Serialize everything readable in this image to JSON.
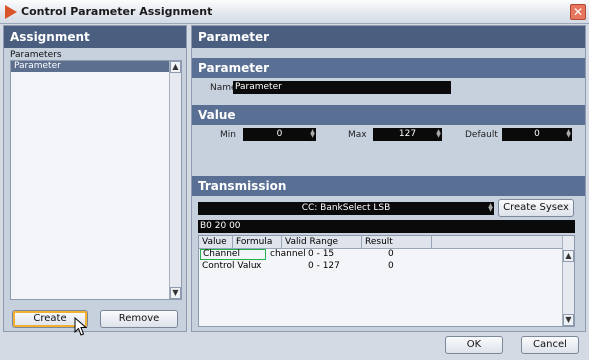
{
  "window": {
    "title": "Control Parameter Assignment",
    "close_glyph": "✕"
  },
  "assignment": {
    "header": "Assignment",
    "parameters_label": "Parameters",
    "list_items": [
      "Parameter"
    ],
    "create_label": "Create",
    "remove_label": "Remove"
  },
  "parameter_panel": {
    "header": "Parameter",
    "section_title": "Parameter",
    "name_label": "Name",
    "name_value": "Parameter"
  },
  "value": {
    "title": "Value",
    "min_label": "Min",
    "min_value": "0",
    "max_label": "Max",
    "max_value": "127",
    "default_label": "Default",
    "default_value": "0"
  },
  "transmission": {
    "title": "Transmission",
    "type_value": "CC: BankSelect LSB",
    "create_sysex_label": "Create Sysex",
    "bytes_value": "B0 20 00",
    "columns": [
      "Value",
      "Formula",
      "Valid Range",
      "Result"
    ],
    "rows": [
      [
        "Channel",
        "channel",
        "0 - 15",
        "0"
      ],
      [
        "Control Valu",
        "x",
        "0 - 127",
        "0"
      ]
    ]
  },
  "footer": {
    "ok_label": "OK",
    "cancel_label": "Cancel"
  },
  "colors": {
    "header": "#4a5e80",
    "panel": "#c7d0dd",
    "selection": "#5d6f8f",
    "field": "#0a0a0a",
    "cell_focus": "#22b14c"
  }
}
